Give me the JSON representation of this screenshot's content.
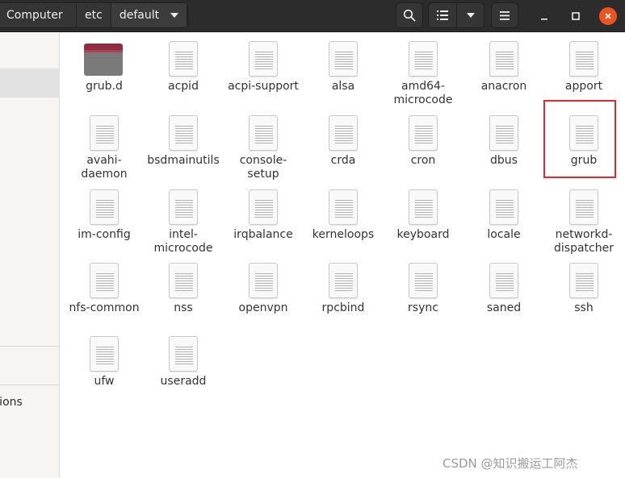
{
  "pathbar": {
    "crumbs": [
      "Computer",
      "etc",
      "default"
    ]
  },
  "toolbar": {
    "search_icon": "search-icon",
    "view_icon": "list-view-icon",
    "view_menu_icon": "chevron-down-icon",
    "menu_icon": "hamburger-menu-icon"
  },
  "window_controls": {
    "minimize": "minimize-icon",
    "maximize": "maximize-icon",
    "close": "close-icon",
    "close_color": "#e95420"
  },
  "sidebar": {
    "visible_label_fragment": "ctions"
  },
  "files": [
    {
      "name": "grub.d",
      "type": "folder"
    },
    {
      "name": "acpid",
      "type": "file"
    },
    {
      "name": "acpi-support",
      "type": "file"
    },
    {
      "name": "alsa",
      "type": "file"
    },
    {
      "name": "amd64-microcode",
      "type": "file"
    },
    {
      "name": "anacron",
      "type": "file"
    },
    {
      "name": "apport",
      "type": "file"
    },
    {
      "name": "avahi-daemon",
      "type": "file"
    },
    {
      "name": "bsdmainutils",
      "type": "file"
    },
    {
      "name": "console-setup",
      "type": "file"
    },
    {
      "name": "crda",
      "type": "file"
    },
    {
      "name": "cron",
      "type": "file"
    },
    {
      "name": "dbus",
      "type": "file"
    },
    {
      "name": "grub",
      "type": "file",
      "highlighted": true
    },
    {
      "name": "im-config",
      "type": "file"
    },
    {
      "name": "intel-microcode",
      "type": "file"
    },
    {
      "name": "irqbalance",
      "type": "file"
    },
    {
      "name": "kerneloops",
      "type": "file"
    },
    {
      "name": "keyboard",
      "type": "file"
    },
    {
      "name": "locale",
      "type": "file"
    },
    {
      "name": "networkd-dispatcher",
      "type": "file"
    },
    {
      "name": "nfs-common",
      "type": "file"
    },
    {
      "name": "nss",
      "type": "file"
    },
    {
      "name": "openvpn",
      "type": "file"
    },
    {
      "name": "rpcbind",
      "type": "file"
    },
    {
      "name": "rsync",
      "type": "file"
    },
    {
      "name": "saned",
      "type": "file"
    },
    {
      "name": "ssh",
      "type": "file"
    },
    {
      "name": "ufw",
      "type": "file"
    },
    {
      "name": "useradd",
      "type": "file"
    }
  ],
  "highlight_color": "#e3282f",
  "watermark": "CSDN @知识搬运工阿杰"
}
